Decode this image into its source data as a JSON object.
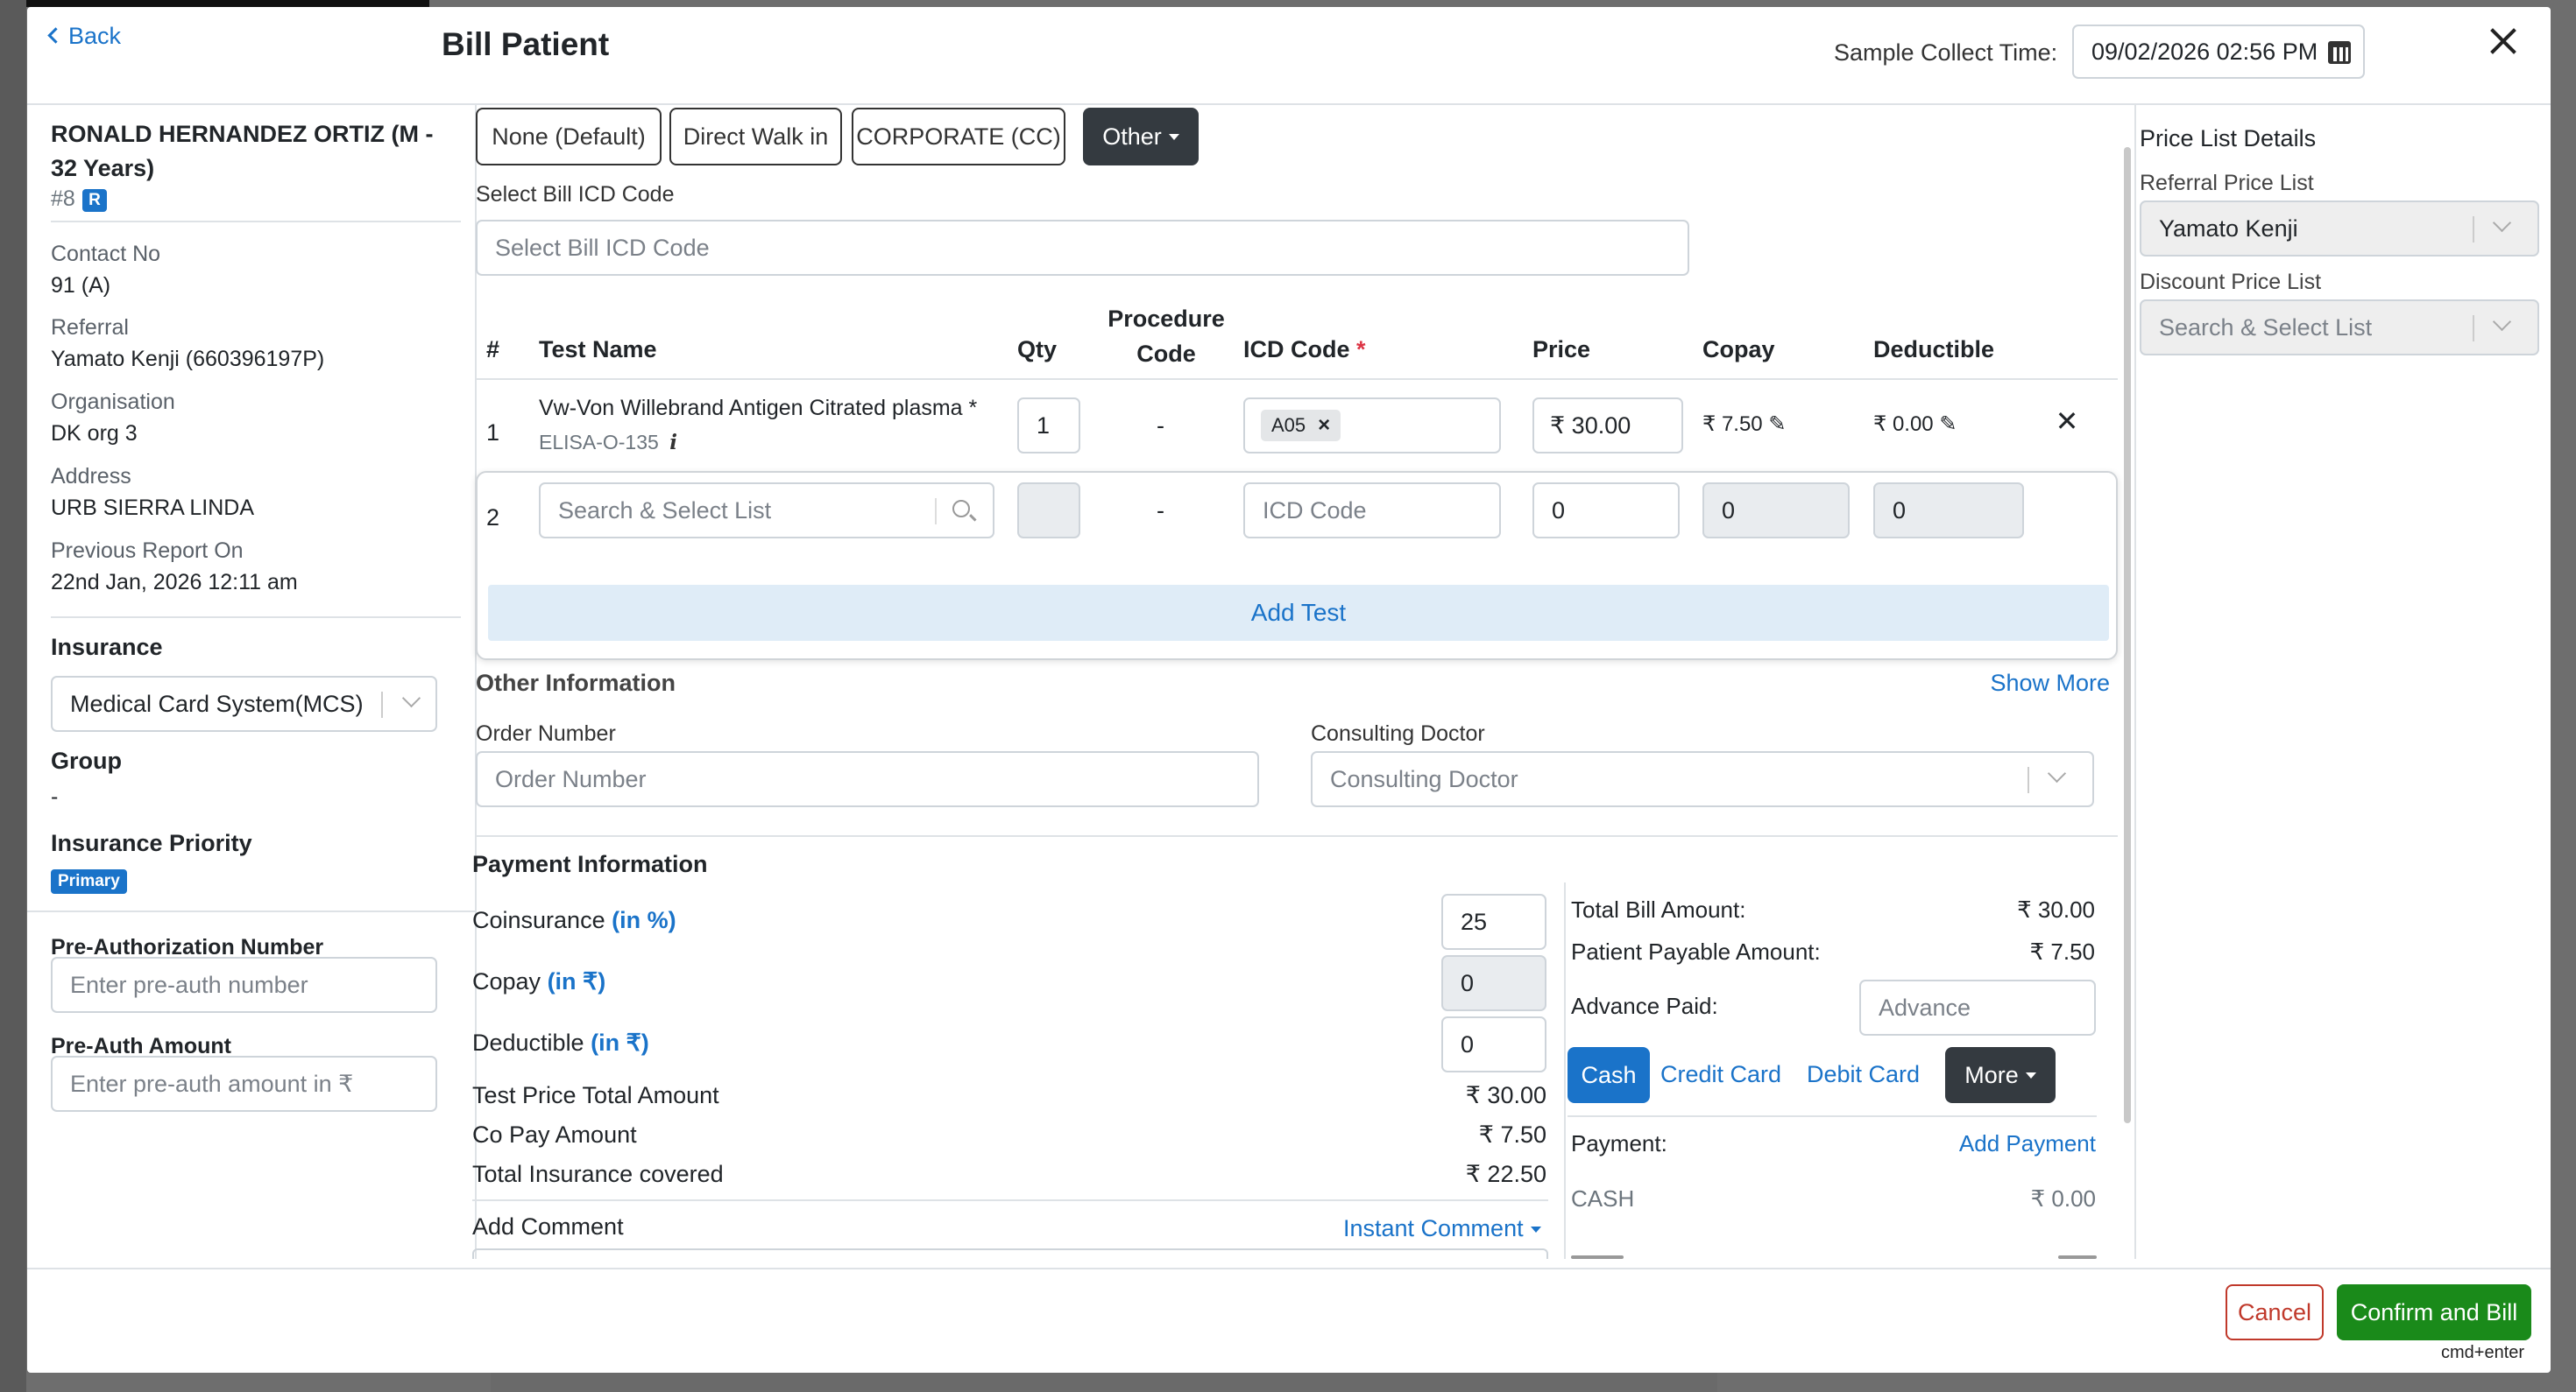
{
  "header": {
    "back_label": "Back",
    "title": "Bill Patient",
    "sample_collect_label": "Sample Collect Time:",
    "sample_collect_value": "09/02/2026 02:56 PM"
  },
  "patient": {
    "name_line1": "RONALD HERNANDEZ ORTIZ (M -",
    "name_line2": "32 Years)",
    "id": "#8",
    "badge": "R",
    "contact_label": "Contact No",
    "contact_value": "91 (A)",
    "referral_label": "Referral",
    "referral_value": "Yamato Kenji (660396197P)",
    "organisation_label": "Organisation",
    "organisation_value": "DK org 3",
    "address_label": "Address",
    "address_value": "URB SIERRA LINDA",
    "prev_report_label": "Previous Report On",
    "prev_report_value": "22nd Jan, 2026 12:11 am"
  },
  "insurance": {
    "label": "Insurance",
    "value": "Medical Card System(MCS)",
    "group_label": "Group",
    "group_value": "-",
    "priority_label": "Insurance Priority",
    "priority_badge": "Primary",
    "preauth_label": "Pre-Authorization Number",
    "preauth_placeholder": "Enter pre-auth number",
    "preauth_amount_label": "Pre-Auth Amount",
    "preauth_amount_placeholder": "Enter pre-auth amount in ₹"
  },
  "bill_types": [
    "None (Default)",
    "Direct Walk in",
    "CORPORATE (CC)"
  ],
  "bill_other_label": "Other",
  "icd": {
    "label": "Select Bill ICD Code",
    "placeholder": "Select Bill ICD Code"
  },
  "table": {
    "headers": {
      "num": "#",
      "test_name": "Test Name",
      "qty": "Qty",
      "procedure_1": "Procedure",
      "procedure_2": "Code",
      "icd": "ICD Code",
      "required": "*",
      "price": "Price",
      "copay": "Copay",
      "deductible": "Deductible"
    },
    "row1": {
      "num": "1",
      "test_name": "Vw-Von Willebrand Antigen Citrated plasma *",
      "test_code": "ELISA-O-135",
      "qty": "1",
      "procedure": "-",
      "icd_tag": "A05",
      "price": "₹ 30.00",
      "copay": "₹ 7.50",
      "deductible": "₹ 0.00"
    },
    "row2": {
      "num": "2",
      "search_placeholder": "Search & Select List",
      "procedure": "-",
      "icd_placeholder": "ICD Code",
      "price": "0",
      "copay": "0",
      "deductible": "0"
    },
    "add_test_label": "Add Test"
  },
  "other_info": {
    "title": "Other Information",
    "show_more": "Show More",
    "order_label": "Order Number",
    "order_placeholder": "Order Number",
    "doctor_label": "Consulting Doctor",
    "doctor_placeholder": "Consulting Doctor"
  },
  "payment": {
    "title": "Payment Information",
    "coinsurance_label": "Coinsurance",
    "coinsurance_unit": "(in %)",
    "coinsurance_value": "25",
    "copay_label": "Copay",
    "copay_unit": "(in ₹)",
    "copay_value": "0",
    "deductible_label": "Deductible",
    "deductible_unit": "(in ₹)",
    "deductible_value": "0",
    "test_total_label": "Test Price Total Amount",
    "test_total_value": "₹ 30.00",
    "copay_amount_label": "Co Pay Amount",
    "copay_amount_value": "₹ 7.50",
    "insurance_covered_label": "Total Insurance covered",
    "insurance_covered_value": "₹ 22.50",
    "add_comment_label": "Add Comment",
    "instant_comment": "Instant Comment"
  },
  "summary": {
    "total_bill_label": "Total Bill Amount:",
    "total_bill_value": "₹ 30.00",
    "patient_payable_label": "Patient Payable Amount:",
    "patient_payable_value": "₹ 7.50",
    "advance_label": "Advance Paid:",
    "advance_placeholder": "Advance",
    "methods": [
      "Cash",
      "Credit Card",
      "Debit Card"
    ],
    "more_label": "More",
    "payment_label": "Payment:",
    "add_payment": "Add Payment",
    "cash_label": "CASH",
    "cash_value": "₹ 0.00"
  },
  "price_list": {
    "title": "Price List Details",
    "referral_label": "Referral Price List",
    "referral_value": "Yamato Kenji",
    "discount_label": "Discount Price List",
    "discount_placeholder": "Search & Select List"
  },
  "footer": {
    "cancel": "Cancel",
    "confirm": "Confirm and Bill",
    "shortcut": "cmd+enter"
  },
  "colors": {
    "primary": "#1a73c9",
    "success": "#1a8a1a",
    "danger": "#c0392b",
    "dark": "#343a40"
  }
}
